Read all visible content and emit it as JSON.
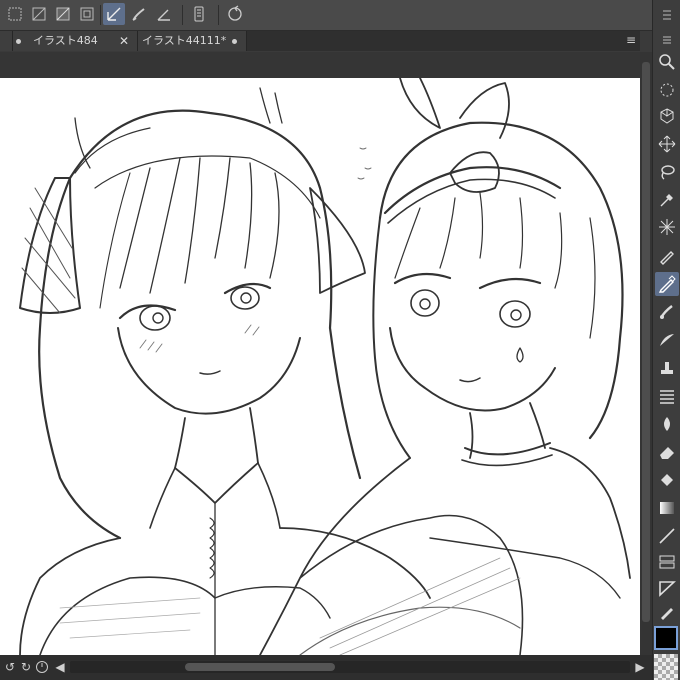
{
  "tabs": [
    {
      "label": "イラスト484",
      "close": "✕"
    },
    {
      "label": "イラスト44111*",
      "close": ""
    }
  ],
  "toolbar": {
    "icons": [
      "select-tool-icon",
      "select-tool-icon",
      "select-tool-icon",
      "select-tool-icon",
      "line-tool-icon",
      "brush-tool-icon",
      "ruler-tool-icon",
      "smartphone-icon",
      "rotate-icon"
    ]
  },
  "right_tools": [
    "zoom-icon",
    "lasso-select-icon",
    "3d-cube-icon",
    "move-icon",
    "lasso-icon",
    "eyedropper-icon",
    "sparkle-icon",
    "pen-icon",
    "pencil-icon",
    "brush-icon",
    "airbrush-icon",
    "stamp-icon",
    "layers-icon",
    "blend-icon",
    "eraser-icon",
    "fill-icon",
    "gradient-icon",
    "line-icon",
    "frame-icon",
    "ruler-icon",
    "correction-icon"
  ],
  "colors": {
    "accent": "#5e6f8c",
    "main_color": "#000000"
  }
}
